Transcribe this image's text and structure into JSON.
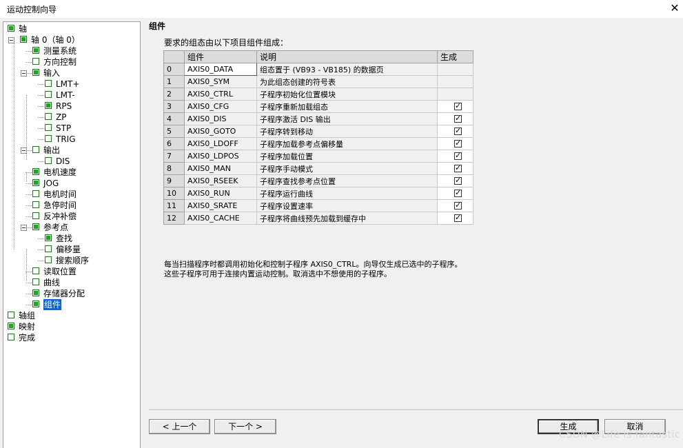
{
  "window": {
    "title": "运动控制向导",
    "close_glyph": "✕"
  },
  "tree": [
    {
      "label": "轴",
      "checked": true,
      "level": 0,
      "expander": false
    },
    {
      "label": "轴 0（轴 0）",
      "checked": true,
      "level": 1,
      "expander": true
    },
    {
      "label": "测量系统",
      "checked": true,
      "level": 2,
      "expander": false
    },
    {
      "label": "方向控制",
      "checked": false,
      "level": 2,
      "expander": false
    },
    {
      "label": "输入",
      "checked": true,
      "level": 2,
      "expander": true
    },
    {
      "label": "LMT+",
      "checked": false,
      "level": 3,
      "expander": false
    },
    {
      "label": "LMT-",
      "checked": false,
      "level": 3,
      "expander": false
    },
    {
      "label": "RPS",
      "checked": true,
      "level": 3,
      "expander": false
    },
    {
      "label": "ZP",
      "checked": false,
      "level": 3,
      "expander": false
    },
    {
      "label": "STP",
      "checked": false,
      "level": 3,
      "expander": false
    },
    {
      "label": "TRIG",
      "checked": false,
      "level": 3,
      "expander": false
    },
    {
      "label": "输出",
      "checked": false,
      "level": 2,
      "expander": true
    },
    {
      "label": "DIS",
      "checked": false,
      "level": 3,
      "expander": false
    },
    {
      "label": "电机速度",
      "checked": true,
      "level": 2,
      "expander": false
    },
    {
      "label": "JOG",
      "checked": true,
      "level": 2,
      "expander": false
    },
    {
      "label": "电机时间",
      "checked": false,
      "level": 2,
      "expander": false
    },
    {
      "label": "急停时间",
      "checked": false,
      "level": 2,
      "expander": false
    },
    {
      "label": "反冲补偿",
      "checked": false,
      "level": 2,
      "expander": false
    },
    {
      "label": "参考点",
      "checked": true,
      "level": 2,
      "expander": true
    },
    {
      "label": "查找",
      "checked": true,
      "level": 3,
      "expander": false
    },
    {
      "label": "偏移量",
      "checked": false,
      "level": 3,
      "expander": false
    },
    {
      "label": "搜索顺序",
      "checked": false,
      "level": 3,
      "expander": false
    },
    {
      "label": "读取位置",
      "checked": false,
      "level": 2,
      "expander": false
    },
    {
      "label": "曲线",
      "checked": false,
      "level": 2,
      "expander": false
    },
    {
      "label": "存储器分配",
      "checked": true,
      "level": 2,
      "expander": false
    },
    {
      "label": "组件",
      "checked": true,
      "level": 2,
      "expander": false,
      "selected": true
    },
    {
      "label": "轴组",
      "checked": false,
      "level": 0,
      "expander": false
    },
    {
      "label": "映射",
      "checked": true,
      "level": 0,
      "expander": false
    },
    {
      "label": "完成",
      "checked": false,
      "level": 0,
      "expander": false
    }
  ],
  "main": {
    "section_title": "组件",
    "description": "要求的组态由以下项目组件组成：",
    "table": {
      "columns": [
        "",
        "组件",
        "说明",
        "生成"
      ],
      "rows": [
        {
          "idx": "0",
          "name": "AXIS0_DATA",
          "desc": "组态置于 (VB93 - VB185) 的数据页",
          "gen": null
        },
        {
          "idx": "1",
          "name": "AXIS0_SYM",
          "desc": "为此组态创建的符号表",
          "gen": null
        },
        {
          "idx": "2",
          "name": "AXIS0_CTRL",
          "desc": "子程序初始化位置模块",
          "gen": null
        },
        {
          "idx": "3",
          "name": "AXIS0_CFG",
          "desc": "子程序重新加载组态",
          "gen": true
        },
        {
          "idx": "4",
          "name": "AXIS0_DIS",
          "desc": "子程序激活 DIS 输出",
          "gen": true
        },
        {
          "idx": "5",
          "name": "AXIS0_GOTO",
          "desc": "子程序转到移动",
          "gen": true
        },
        {
          "idx": "6",
          "name": "AXIS0_LDOFF",
          "desc": "子程序加载参考点偏移量",
          "gen": true
        },
        {
          "idx": "7",
          "name": "AXIS0_LDPOS",
          "desc": "子程序加载位置",
          "gen": true
        },
        {
          "idx": "8",
          "name": "AXIS0_MAN",
          "desc": "子程序手动模式",
          "gen": true
        },
        {
          "idx": "9",
          "name": "AXIS0_RSEEK",
          "desc": "子程序查找参考点位置",
          "gen": true
        },
        {
          "idx": "10",
          "name": "AXIS0_RUN",
          "desc": "子程序运行曲线",
          "gen": true
        },
        {
          "idx": "11",
          "name": "AXIS0_SRATE",
          "desc": "子程序设置速率",
          "gen": true
        },
        {
          "idx": "12",
          "name": "AXIS0_CACHE",
          "desc": "子程序将曲线预先加载到缓存中",
          "gen": true
        }
      ]
    },
    "note_line1": "每当扫描程序时都调用初始化和控制子程序 AXIS0_CTRL。向导仅生成已选中的子程序。",
    "note_line2": "这些子程序可用于连接内置运动控制。取消选中不想使用的子程序。"
  },
  "buttons": {
    "prev": "< 上一个",
    "next": "下一个 >",
    "generate": "生成",
    "cancel": "取消"
  },
  "watermark": "CSDN @Life is fantastic"
}
